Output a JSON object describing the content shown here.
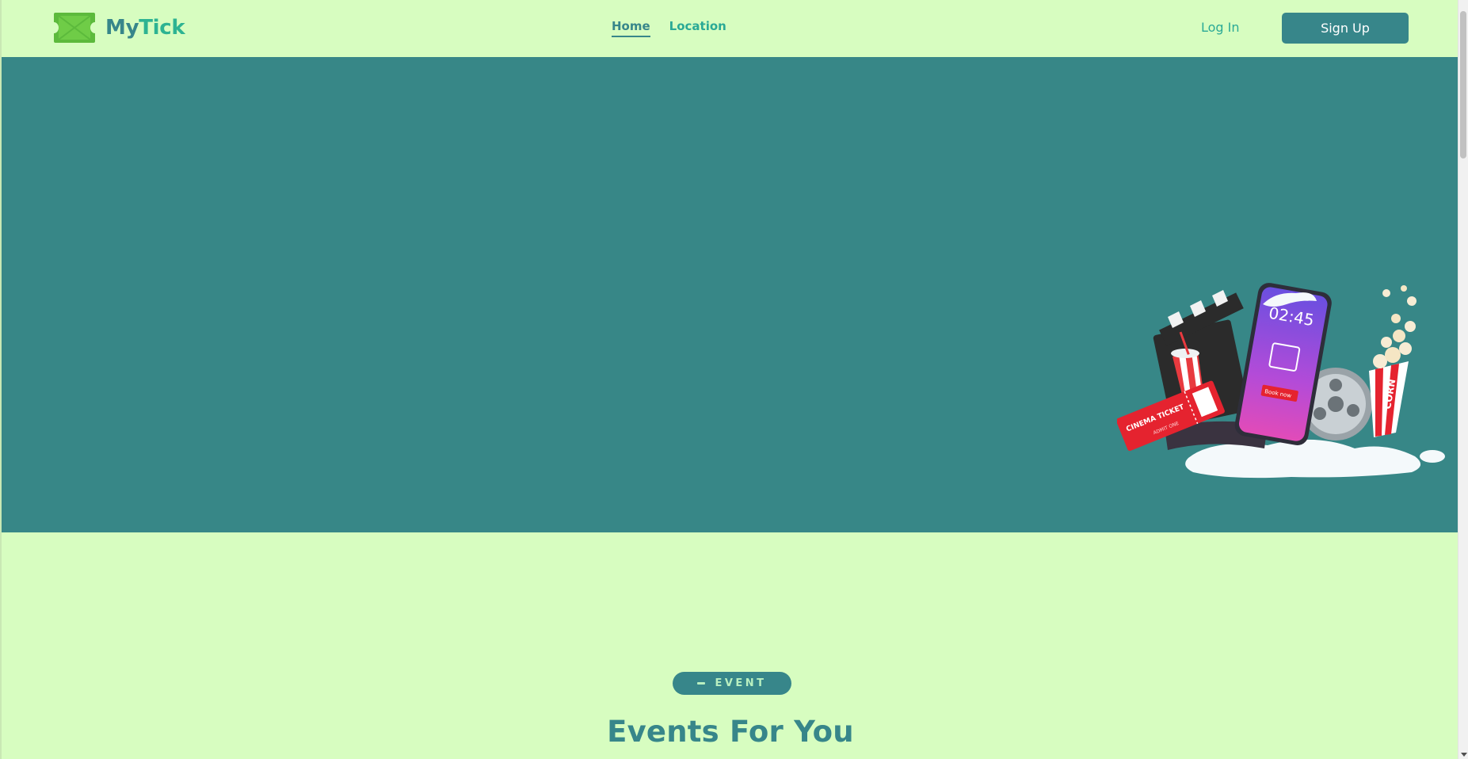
{
  "header": {
    "logo": {
      "brand_part1": "My",
      "brand_part2": "Tick",
      "icon": "ticket-icon"
    },
    "nav": [
      {
        "label": "Home",
        "active": true
      },
      {
        "label": "Location",
        "active": false
      }
    ],
    "login_label": "Log In",
    "signup_label": "Sign Up"
  },
  "hero": {
    "illustration": "cinema-illustration",
    "phone_time": "02:45",
    "phone_button": "Book now",
    "ticket_text": "CINEMA TICKET",
    "ticket_subtext": "ADMIT ONE",
    "popcorn_text": "CORN"
  },
  "events": {
    "badge_label": "EVENT",
    "title": "Events For You"
  },
  "colors": {
    "background": "#d7fdc0",
    "primary": "#37868a",
    "accent": "#2db392",
    "hero": "#378787"
  }
}
